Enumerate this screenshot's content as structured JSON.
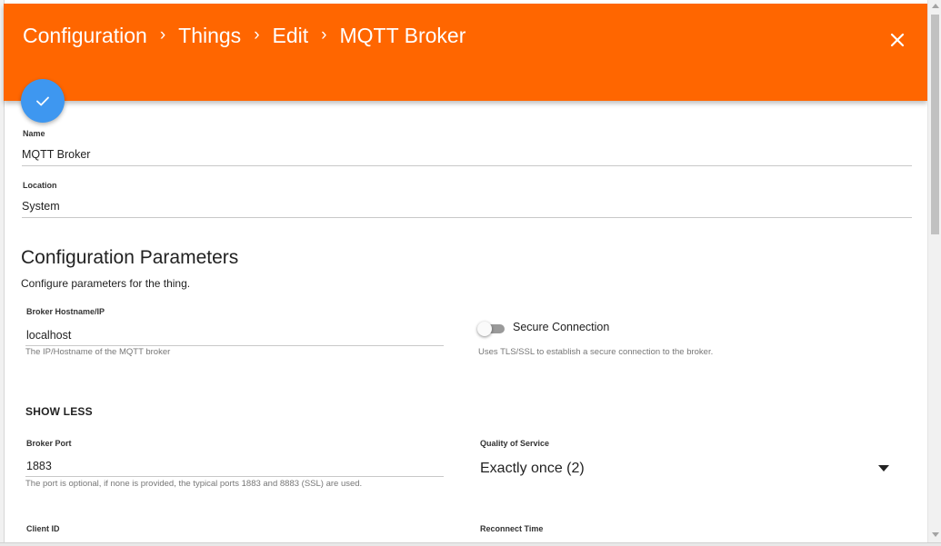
{
  "header": {
    "breadcrumb": [
      "Configuration",
      "Things",
      "Edit",
      "MQTT Broker"
    ],
    "separator": "›",
    "background": "#ff6600",
    "close_icon": "close-icon"
  },
  "fab": {
    "icon": "check-icon",
    "color": "#3e97f0"
  },
  "form": {
    "name": {
      "label": "Name",
      "value": "MQTT Broker"
    },
    "location": {
      "label": "Location",
      "value": "System"
    }
  },
  "config": {
    "title": "Configuration Parameters",
    "description": "Configure parameters for the thing.",
    "broker_host": {
      "label": "Broker Hostname/IP",
      "value": "localhost",
      "hint": "The IP/Hostname of the MQTT broker"
    },
    "secure_connection": {
      "label": "Secure Connection",
      "enabled": false,
      "hint": "Uses TLS/SSL to establish a secure connection to the broker."
    },
    "show_less": "SHOW LESS",
    "broker_port": {
      "label": "Broker Port",
      "value": "1883",
      "hint": "The port is optional, if none is provided, the typical ports 1883 and 8883 (SSL) are used."
    },
    "qos": {
      "label": "Quality of Service",
      "value": "Exactly once (2)"
    },
    "client_id": {
      "label": "Client ID"
    },
    "reconnect_time": {
      "label": "Reconnect Time"
    }
  }
}
